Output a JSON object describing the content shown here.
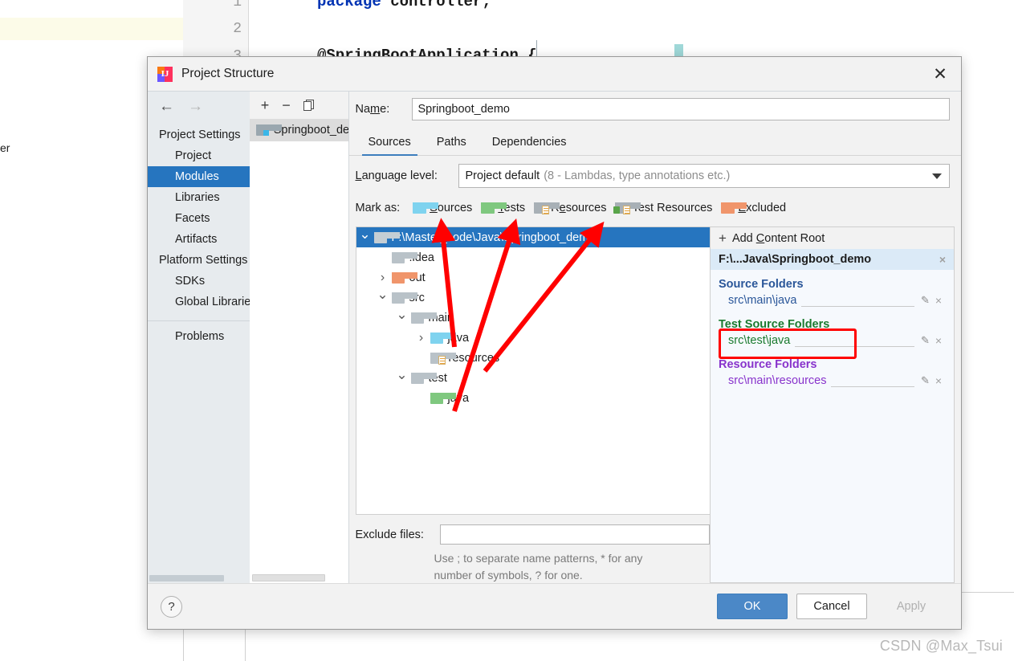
{
  "background": {
    "gutter_numbers": [
      "1",
      "2",
      "3"
    ],
    "code_lines": [
      {
        "keyword": "package",
        "rest": " controller;"
      },
      {
        "keyword": "",
        "rest": "@SpringBootApplication {"
      }
    ],
    "left_fragment": "er",
    "watermark": "CSDN @Max_Tsui"
  },
  "dialog": {
    "title": "Project Structure",
    "logo_text": "IJ",
    "close_icon": "✕",
    "nav": {
      "back_icon": "←",
      "forward_icon": "→",
      "groups": [
        {
          "label": "Project Settings",
          "items": [
            {
              "label": "Project",
              "selected": false
            },
            {
              "label": "Modules",
              "selected": true
            },
            {
              "label": "Libraries",
              "selected": false
            },
            {
              "label": "Facets",
              "selected": false
            },
            {
              "label": "Artifacts",
              "selected": false
            }
          ]
        },
        {
          "label": "Platform Settings",
          "items": [
            {
              "label": "SDKs",
              "selected": false
            },
            {
              "label": "Global Libraries",
              "selected": false
            }
          ]
        }
      ],
      "problems_label": "Problems"
    },
    "module_list": {
      "toolbar": {
        "add": "+",
        "remove": "−",
        "copy": "copy"
      },
      "modules": [
        {
          "label": "Springboot_demo"
        }
      ]
    },
    "detail": {
      "name_label_pre": "Na",
      "name_label_underline": "m",
      "name_label_post": "e:",
      "name_value": "Springboot_demo",
      "tabs": [
        {
          "label": "Sources",
          "active": true
        },
        {
          "label": "Paths",
          "active": false
        },
        {
          "label": "Dependencies",
          "active": false
        }
      ],
      "language_level_label_pre": "",
      "language_level_label_underline": "L",
      "language_level_label_post": "anguage level:",
      "language_level_value": "Project default",
      "language_level_hint": "(8 - Lambdas, type annotations etc.)",
      "mark_as_label": "Mark as:",
      "mark_as_buttons": [
        {
          "pre": "",
          "under": "S",
          "post": "ources",
          "icon": "sources-folder-icon",
          "color": "#7fd3ef"
        },
        {
          "pre": "",
          "under": "T",
          "post": "ests",
          "icon": "tests-folder-icon",
          "color": "#7fc87f"
        },
        {
          "pre": "R",
          "under": "e",
          "post": "sources",
          "icon": "resources-folder-icon",
          "color": "#a8b0b6"
        },
        {
          "pre": "Test Resources",
          "under": "",
          "post": "",
          "icon": "test-resources-folder-icon",
          "color": "#a8b0b6"
        },
        {
          "pre": "",
          "under": "E",
          "post": "xcluded",
          "icon": "excluded-folder-icon",
          "color": "#f0956b"
        }
      ],
      "tree": [
        {
          "label": "F:\\Master_code\\Java\\Springboot_demo",
          "indent": 0,
          "twisty": "down",
          "icon": "folder",
          "color": "#b9c2c8",
          "selected": true
        },
        {
          "label": ".idea",
          "indent": 1,
          "twisty": "none",
          "icon": "folder",
          "color": "#b9c2c8",
          "selected": false
        },
        {
          "label": "out",
          "indent": 1,
          "twisty": "right",
          "icon": "folder",
          "color": "#f0956b",
          "selected": false
        },
        {
          "label": "src",
          "indent": 1,
          "twisty": "down",
          "icon": "folder",
          "color": "#b9c2c8",
          "selected": false
        },
        {
          "label": "main",
          "indent": 2,
          "twisty": "down",
          "icon": "folder",
          "color": "#b9c2c8",
          "selected": false
        },
        {
          "label": "java",
          "indent": 3,
          "twisty": "right",
          "icon": "folder",
          "color": "#7fd3ef",
          "selected": false
        },
        {
          "label": "resources",
          "indent": 3,
          "twisty": "none",
          "icon": "resource-folder",
          "color": "#b9c2c8",
          "selected": false
        },
        {
          "label": "test",
          "indent": 2,
          "twisty": "down",
          "icon": "folder",
          "color": "#b9c2c8",
          "selected": false
        },
        {
          "label": "java",
          "indent": 3,
          "twisty": "none",
          "icon": "folder",
          "color": "#7fc87f",
          "selected": false
        }
      ],
      "exclude_label": "Exclude files:",
      "exclude_value": "",
      "exclude_hint_line1": "Use ; to separate name patterns, * for any",
      "exclude_hint_line2": "number of symbols, ? for one."
    },
    "folders_pane": {
      "add_root_pre": "Add ",
      "add_root_under": "C",
      "add_root_post": "ontent Root",
      "add_root_plus": "+",
      "root_path": "F:\\...Java\\Springboot_demo",
      "root_close": "×",
      "groups": [
        {
          "title": "Source Folders",
          "kind": "src",
          "paths": [
            "src\\main\\java"
          ]
        },
        {
          "title": "Test Source Folders",
          "kind": "test",
          "paths": [
            "src\\test\\java"
          ]
        },
        {
          "title": "Resource Folders",
          "kind": "res",
          "paths": [
            "src\\main\\resources"
          ]
        }
      ],
      "edit_icon": "✎",
      "remove_icon": "×"
    },
    "footer": {
      "help_label": "?",
      "ok_label": "OK",
      "cancel_label": "Cancel",
      "apply_label": "Apply"
    }
  },
  "annotations": {
    "highlight_color": "#ff0000",
    "arrows": [
      {
        "from": "src/main/java tree node",
        "to": "Sources mark-as button"
      },
      {
        "from": "src/test/java tree node",
        "to": "Tests mark-as button"
      },
      {
        "from": "src/main/resources tree node",
        "to": "Resources mark-as button"
      }
    ],
    "box_target": "Test Source Folders"
  }
}
